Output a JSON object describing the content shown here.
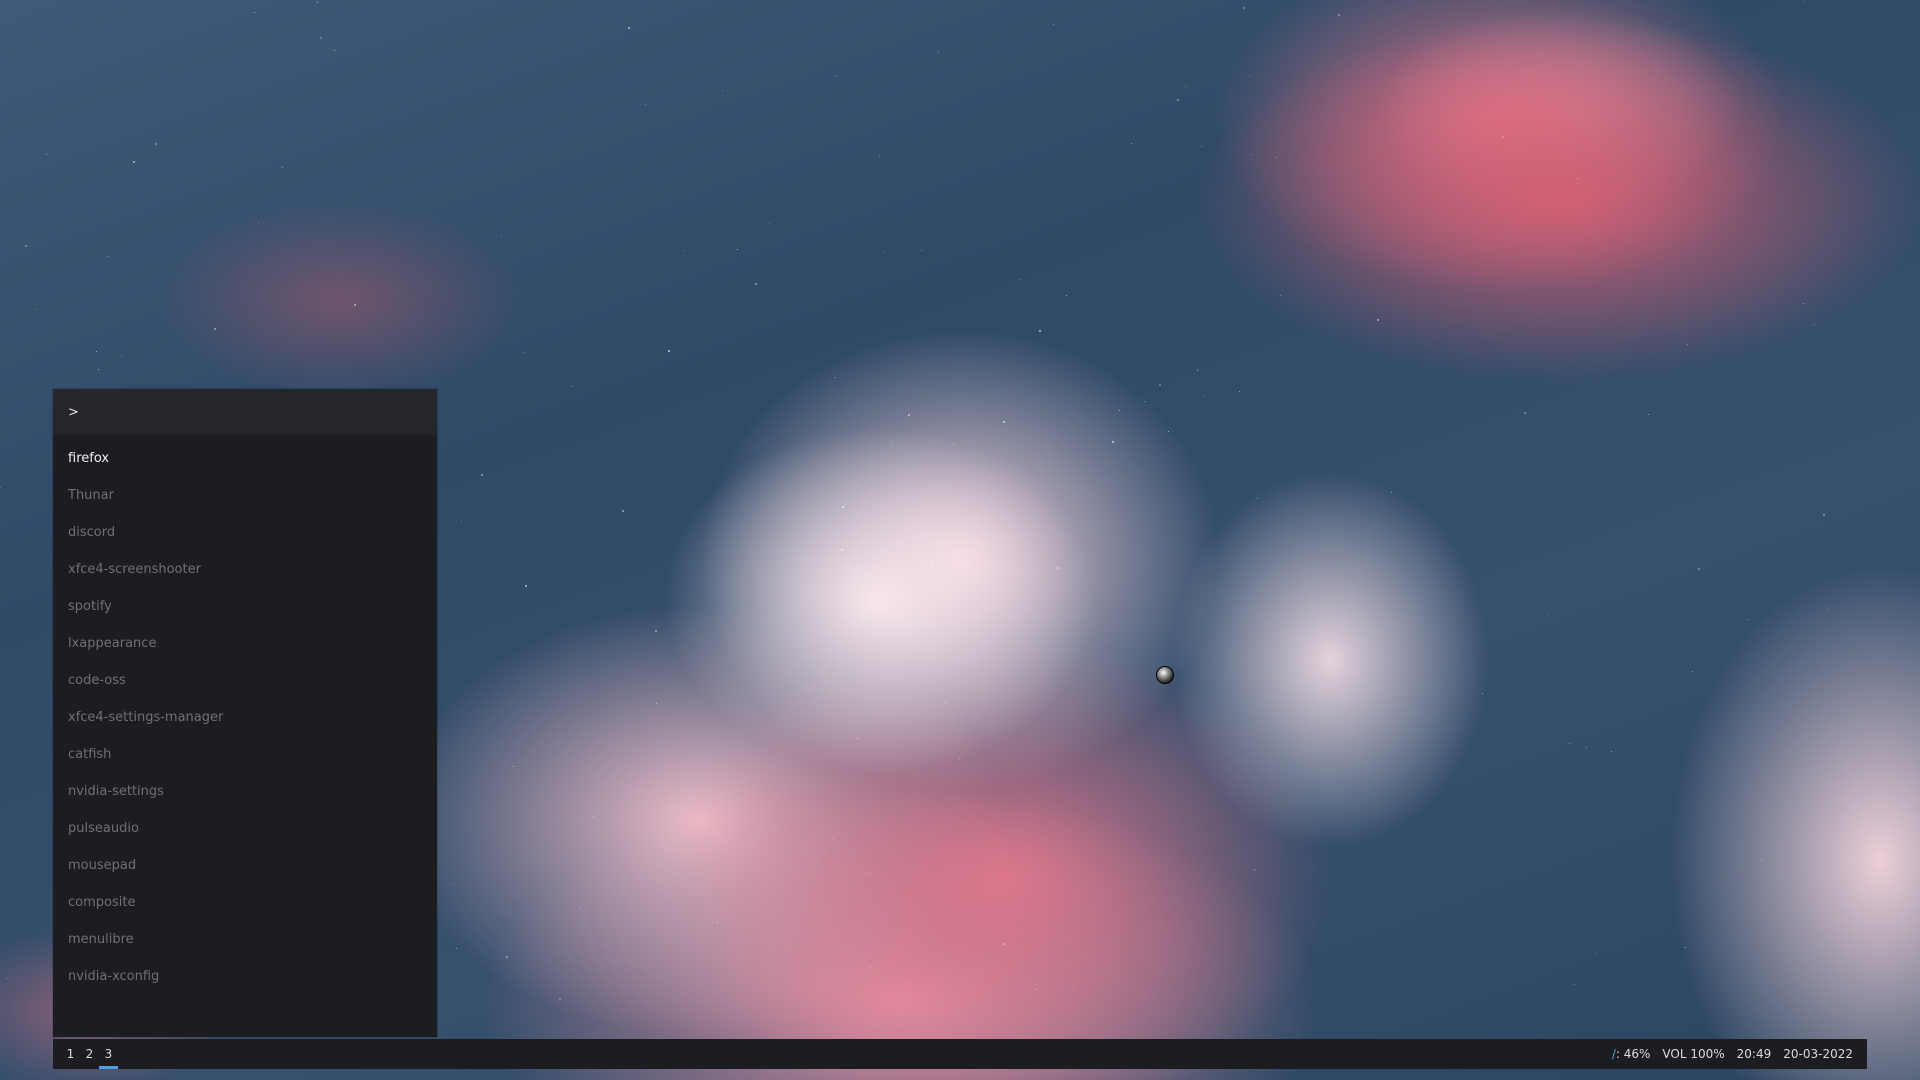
{
  "launcher": {
    "prompt": ">",
    "input_value": "",
    "items": [
      {
        "label": "firefox",
        "selected": true
      },
      {
        "label": "Thunar",
        "selected": false
      },
      {
        "label": "discord",
        "selected": false
      },
      {
        "label": "xfce4-screenshooter",
        "selected": false
      },
      {
        "label": "spotify",
        "selected": false
      },
      {
        "label": "lxappearance",
        "selected": false
      },
      {
        "label": "code-oss",
        "selected": false
      },
      {
        "label": "xfce4-settings-manager",
        "selected": false
      },
      {
        "label": "catfish",
        "selected": false
      },
      {
        "label": "nvidia-settings",
        "selected": false
      },
      {
        "label": "pulseaudio",
        "selected": false
      },
      {
        "label": "mousepad",
        "selected": false
      },
      {
        "label": "composite",
        "selected": false
      },
      {
        "label": "menulibre",
        "selected": false
      },
      {
        "label": "nvidia-xconfig",
        "selected": false
      }
    ]
  },
  "bar": {
    "workspaces": [
      {
        "label": "1",
        "active": false
      },
      {
        "label": "2",
        "active": false
      },
      {
        "label": "3",
        "active": true
      }
    ],
    "disk_icon": "/",
    "disk": ": 46%",
    "volume": "VOL 100%",
    "time": "20:49",
    "date": "20-03-2022"
  },
  "colors": {
    "accent": "#4aa3df",
    "panel_bg": "#1c1d21",
    "prompt_bg": "#25262b",
    "item_dim": "#6f7075",
    "item_selected": "#f2f2f2"
  }
}
